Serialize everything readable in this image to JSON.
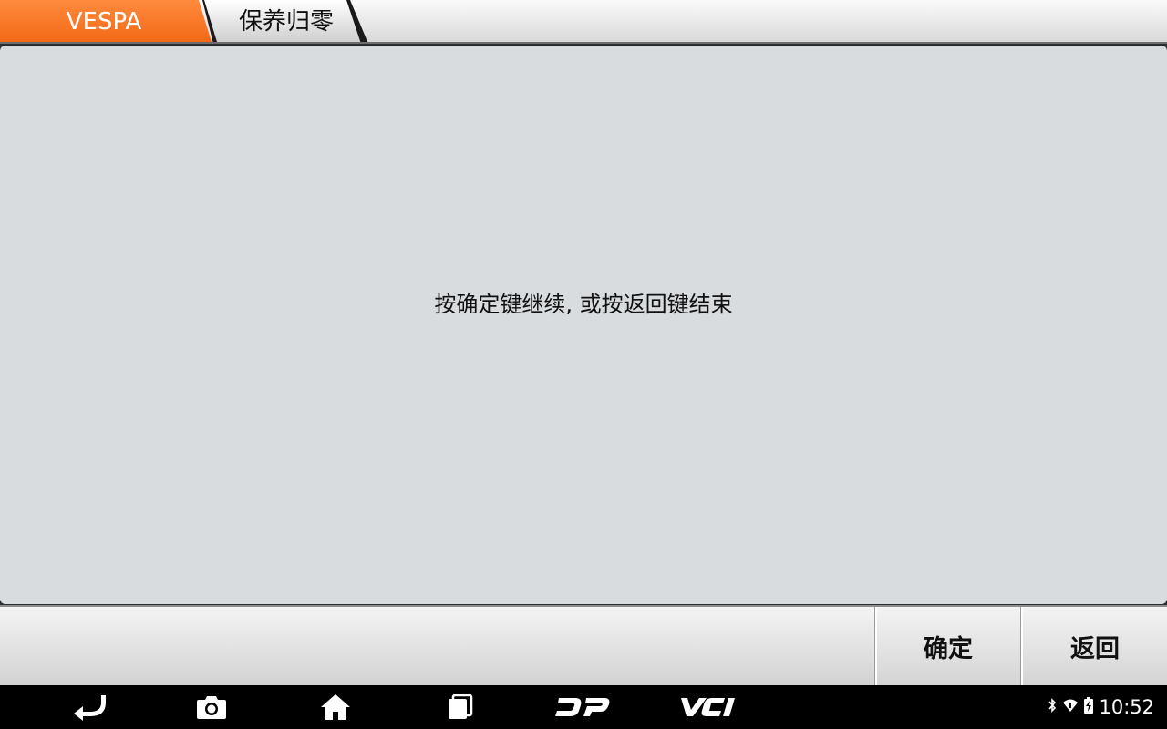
{
  "breadcrumb": {
    "items": [
      {
        "label": "VESPA",
        "color": "#f36f21"
      },
      {
        "label": "保养归零"
      }
    ]
  },
  "main": {
    "message": "按确定键继续, 或按返回键结束"
  },
  "buttons": {
    "confirm_label": "确定",
    "back_label": "返回"
  },
  "navbar": {
    "icons": [
      "back-arrow-icon",
      "camera-icon",
      "home-icon",
      "recent-apps-icon",
      "dp-logo-icon",
      "vci-logo-icon"
    ],
    "dp_label": "DP",
    "vci_label": "VCI"
  },
  "status": {
    "icons": [
      "bluetooth-icon",
      "wifi-icon",
      "battery-charging-icon"
    ],
    "time": "10:52"
  }
}
